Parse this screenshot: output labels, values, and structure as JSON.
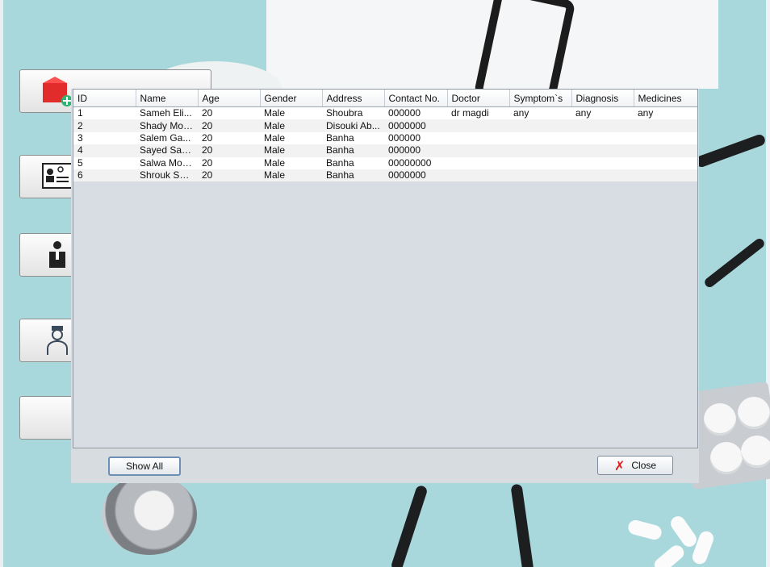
{
  "table": {
    "columns": [
      "ID",
      "Name",
      "Age",
      "Gender",
      "Address",
      "Contact No.",
      "Doctor",
      "Symptom`s",
      "Diagnosis",
      "Medicines"
    ],
    "rows": [
      [
        "1",
        "Sameh Eli...",
        "20",
        "Male",
        "Shoubra",
        "000000",
        "dr magdi",
        "any",
        "any",
        "any"
      ],
      [
        "2",
        "Shady Moh...",
        "20",
        "Male",
        "Disouki Ab...",
        "0000000",
        "",
        "",
        "",
        ""
      ],
      [
        "3",
        "Salem Ga...",
        "20",
        "Male",
        "Banha",
        "000000",
        "",
        "",
        "",
        ""
      ],
      [
        "4",
        "Sayed Samir",
        "20",
        "Male",
        "Banha",
        "000000",
        "",
        "",
        "",
        ""
      ],
      [
        "5",
        "Salwa Moh...",
        "20",
        "Male",
        "Banha",
        "00000000",
        "",
        "",
        "",
        ""
      ],
      [
        "6",
        "Shrouk Sal...",
        "20",
        "Male",
        "Banha",
        "0000000",
        "",
        "",
        "",
        ""
      ]
    ]
  },
  "buttons": {
    "show_all": "Show All",
    "close": "Close"
  },
  "icons": {
    "add_patient": "add-patient-box-icon",
    "patient_card": "id-card-icon",
    "doctor": "doctor-icon",
    "nurse": "nurse-icon",
    "close": "x-icon"
  }
}
